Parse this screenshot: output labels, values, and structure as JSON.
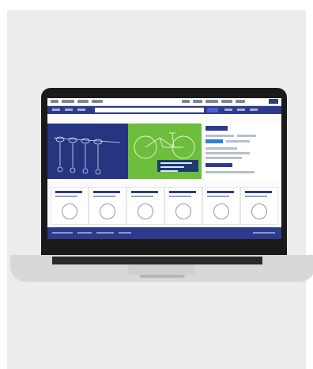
{
  "device": {
    "name": "laptop",
    "colors": {
      "background": "#ececec",
      "bezel": "#1a1a1a",
      "screen_bg": "#fbfbfb",
      "brand_navy": "#2d3b8c",
      "accent_green": "#6dbe3d"
    }
  },
  "icons": {
    "logo": "logo",
    "search": "search-icon",
    "product": "product-icon",
    "nav_chevron": "chevron-down-icon"
  }
}
